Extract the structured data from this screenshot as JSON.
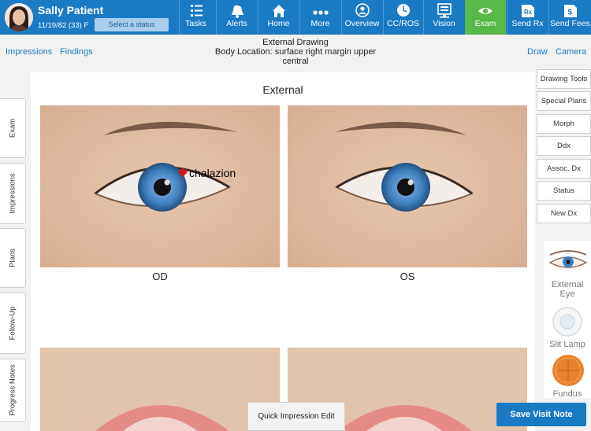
{
  "patient": {
    "name": "Sally Patient",
    "info": "11/19/82 (33) F",
    "status_button": "Select a status"
  },
  "nav": [
    {
      "label": "Tasks",
      "icon": "tasks-icon"
    },
    {
      "label": "Alerts",
      "icon": "alerts-icon"
    },
    {
      "label": "Home",
      "icon": "home-icon"
    },
    {
      "label": "More",
      "icon": "more-icon"
    },
    {
      "label": "Overview",
      "icon": "overview-icon"
    },
    {
      "label": "CC/ROS",
      "icon": "clock-icon"
    },
    {
      "label": "Vision",
      "icon": "vision-icon"
    },
    {
      "label": "Exam",
      "icon": "eye-icon",
      "active": true
    },
    {
      "label": "Send Rx",
      "icon": "send-rx-icon"
    },
    {
      "label": "Send Fees",
      "icon": "send-fees-icon"
    }
  ],
  "subheader": {
    "impressions_link": "Impressions",
    "findings_link": "Findings",
    "drawing_title": "External Drawing",
    "body_location": "Body Location: surface right margin upper central",
    "draw_link": "Draw",
    "camera_link": "Camera"
  },
  "left_tabs": [
    "Exam",
    "Impressions",
    "Plans",
    "Follow-Up",
    "Progress Notes"
  ],
  "canvas": {
    "title": "External",
    "od_label": "OD",
    "os_label": "OS",
    "annotation": "chalazion"
  },
  "right_buttons": [
    "Drawing Tools",
    "Special Plans",
    "Morph",
    "Ddx",
    "Assoc. Dx",
    "Status",
    "New Dx"
  ],
  "thumbnails": [
    {
      "label": "External Eye"
    },
    {
      "label": "Slit Lamp"
    },
    {
      "label": "Fundus"
    }
  ],
  "bottom": {
    "quick_edit": "Quick Impression Edit",
    "save": "Save Visit Note"
  },
  "colors": {
    "accent": "#1a7bc4",
    "active_tab": "#57b947",
    "iris": "#3f7fc0"
  }
}
